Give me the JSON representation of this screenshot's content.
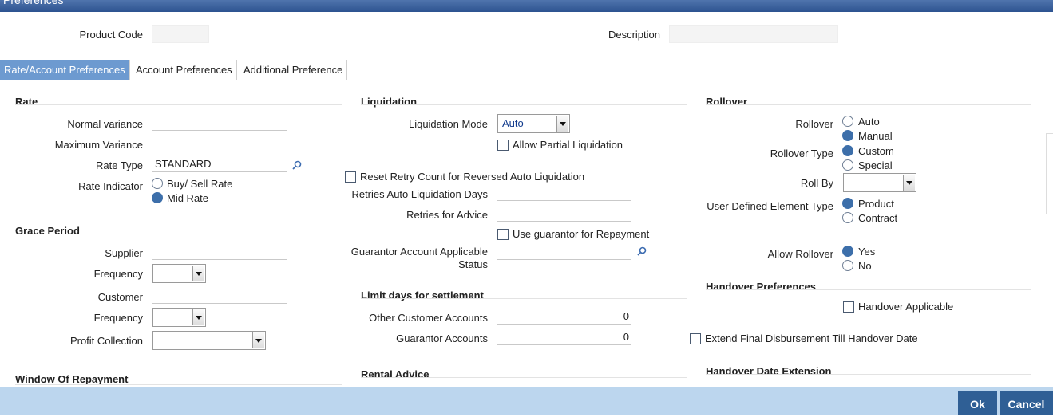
{
  "window": {
    "title": "Preferences"
  },
  "header": {
    "product_code_label": "Product Code",
    "description_label": "Description"
  },
  "tabs": [
    "Rate/Account Preferences",
    "Account Preferences",
    "Additional Preference"
  ],
  "rate": {
    "section": "Rate",
    "normal_variance_label": "Normal variance",
    "maximum_variance_label": "Maximum Variance",
    "rate_type_label": "Rate Type",
    "rate_type_value": "STANDARD",
    "rate_indicator_label": "Rate Indicator",
    "rate_indicator_options": [
      "Buy/ Sell Rate",
      "Mid Rate"
    ],
    "rate_indicator_selected": "Mid Rate"
  },
  "grace_period": {
    "section": "Grace Period",
    "supplier_label": "Supplier",
    "frequency_label": "Frequency",
    "customer_label": "Customer",
    "frequency2_label": "Frequency",
    "profit_collection_label": "Profit Collection"
  },
  "window_of_repayment": {
    "section": "Window Of Repayment"
  },
  "liquidation": {
    "section": "Liquidation",
    "mode_label": "Liquidation Mode",
    "mode_value": "Auto",
    "allow_partial_label": "Allow Partial Liquidation",
    "reset_retry_label": "Reset Retry Count for Reversed Auto Liquidation",
    "retries_auto_label": "Retries Auto Liquidation Days",
    "retries_advice_label": "Retries for Advice",
    "use_guarantor_label": "Use guarantor for Repayment",
    "guarantor_status_label_1": "Guarantor Account Applicable",
    "guarantor_status_label_2": "Status"
  },
  "limit_days": {
    "section": "Limit days for settlement",
    "other_customer_label": "Other Customer Accounts",
    "other_customer_value": "0",
    "guarantor_label": "Guarantor Accounts",
    "guarantor_value": "0"
  },
  "rental_advice": {
    "section": "Rental Advice"
  },
  "rollover": {
    "section": "Rollover",
    "rollover_label": "Rollover",
    "rollover_options": [
      "Auto",
      "Manual"
    ],
    "rollover_selected": "Manual",
    "type_label": "Rollover Type",
    "type_options": [
      "Custom",
      "Special"
    ],
    "type_selected": "Custom",
    "roll_by_label": "Roll By",
    "ude_type_label": "User Defined Element Type",
    "ude_options": [
      "Product",
      "Contract"
    ],
    "ude_selected": "Product",
    "allow_label": "Allow Rollover",
    "allow_options": [
      "Yes",
      "No"
    ],
    "allow_selected": "Yes"
  },
  "handover": {
    "section": "Handover Preferences",
    "applicable_label": "Handover Applicable",
    "extend_label": "Extend Final Disbursement Till Handover Date",
    "date_extension_section": "Handover Date Extension"
  },
  "footer": {
    "ok_label": "Ok",
    "cancel_label": "Cancel"
  },
  "colors": {
    "title_bar": "#2d5390",
    "active_tab": "#6d9ad0",
    "footer": "#bcd6ee",
    "button": "#2f5f95",
    "radio_selected": "#3d6faa"
  }
}
